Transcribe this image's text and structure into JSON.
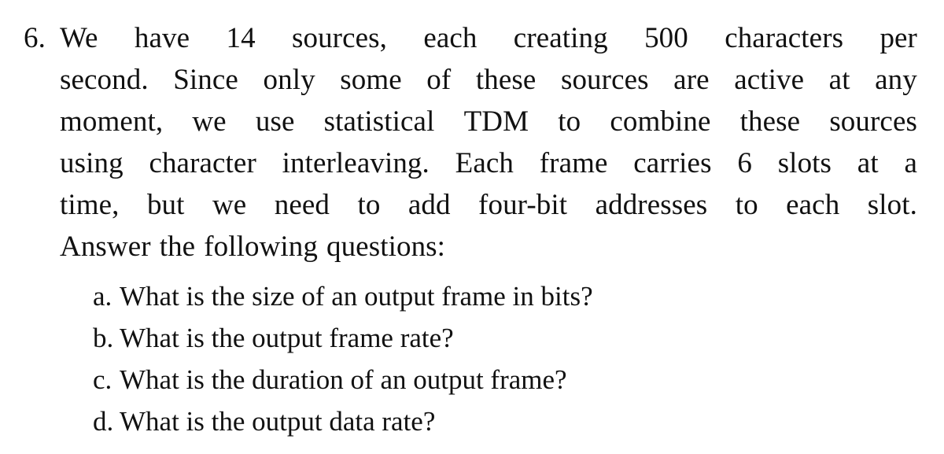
{
  "document": {
    "type": "textbook-exercise-question",
    "background_color": "#ffffff",
    "text_color": "#111111"
  },
  "question": {
    "number": "6.",
    "lines": [
      {
        "id": "line-1",
        "text": "We have 14 sources, each creating 500 characters per",
        "words": [
          "We",
          "have",
          "14",
          "sources,",
          "each",
          "creating",
          "500",
          "characters",
          "per"
        ],
        "justified": true
      },
      {
        "id": "line-2",
        "text": "second. Since only some of these sources are active at any",
        "words": [
          "second.",
          "Since",
          "only",
          "some",
          "of",
          "these",
          "sources",
          "are",
          "active",
          "at",
          "any"
        ],
        "justified": true
      },
      {
        "id": "line-3",
        "text": "moment, we use statistical TDM to combine these sources",
        "words": [
          "moment,",
          "we",
          "use",
          "statistical",
          "TDM",
          "to",
          "combine",
          "these",
          "sources"
        ],
        "justified": true
      },
      {
        "id": "line-4",
        "text": "using character interleaving. Each frame carries 6 slots at a",
        "words": [
          "using",
          "character",
          "interleaving.",
          "Each",
          "frame",
          "carries",
          "6",
          "slots",
          "at",
          "a"
        ],
        "justified": true
      },
      {
        "id": "line-5",
        "text": "time, but we need to add four-bit addresses to each slot.",
        "words": [
          "time,",
          "but",
          "we",
          "need",
          "to",
          "add",
          "four-bit",
          "addresses",
          "to",
          "each",
          "slot."
        ],
        "justified": true
      },
      {
        "id": "line-6",
        "text": "Answer the following questions:",
        "words": [
          "Answer",
          "the",
          "following",
          "questions:"
        ],
        "justified": false
      }
    ],
    "full_text": "6. We have 14 sources, each creating 500 characters per second. Since only some of these sources are active at any moment, we use statistical TDM to combine these sources using character interleaving. Each frame carries 6 slots at a time, but we need to add four-bit addresses to each slot. Answer the following questions:"
  },
  "sub_questions": [
    {
      "marker": "a.",
      "text": "What is the size of an output frame in bits?"
    },
    {
      "marker": "b.",
      "text": "What is the output frame rate?"
    },
    {
      "marker": "c.",
      "text": "What is the duration of an output frame?"
    },
    {
      "marker": "d.",
      "text": "What is the output data rate?"
    }
  ],
  "values": {
    "num_sources": "14",
    "characters_per_second": "500",
    "slots_per_frame": "6",
    "address_bits": "four-bit"
  }
}
